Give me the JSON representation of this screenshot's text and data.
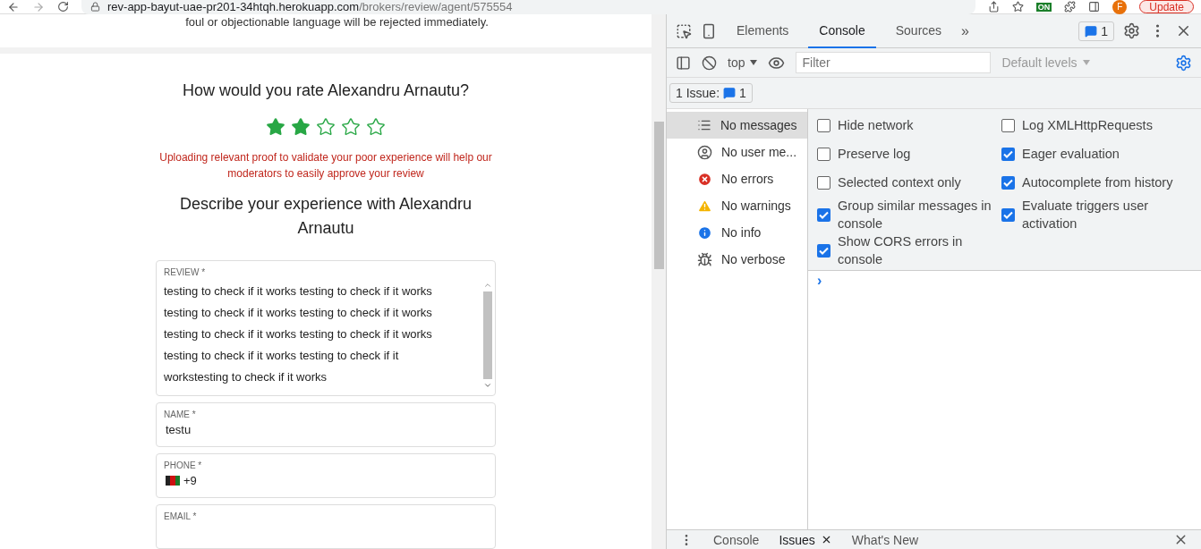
{
  "browser": {
    "url_host": "rev-app-bayut-uae-pr201-34htqh.herokuapp.com",
    "url_path": "/brokers/review/agent/575554",
    "extension_badge": "ON",
    "profile_initial": "F",
    "update_button": "Update"
  },
  "page": {
    "notice": "foul or objectionable language will be rejected immediately.",
    "rate_title": "How would you rate Alexandru Arnautu?",
    "stars": 2,
    "proof_note": "Uploading relevant proof to validate your poor experience will help our moderators to easily approve your review",
    "describe_title": "Describe your experience with Alexandru Arnautu",
    "review": {
      "label": "REVIEW *",
      "value": "testing to check if it works testing to check if it works testing to check if it works testing to check if it works testing to check if it works testing to check if it works testing to check if it works testing to check if it workstesting to check if it works"
    },
    "name": {
      "label": "NAME *",
      "value": "testu"
    },
    "phone": {
      "label": "PHONE *",
      "value": "+9"
    },
    "email": {
      "label": "EMAIL *"
    }
  },
  "devtools": {
    "tabs": [
      {
        "label": "Elements",
        "selected": false
      },
      {
        "label": "Console",
        "selected": true
      },
      {
        "label": "Sources",
        "selected": false
      }
    ],
    "more_tabs": "»",
    "issues_badge": "1",
    "context": "top",
    "filter": {
      "placeholder": "Filter"
    },
    "levels": "Default levels",
    "issues_button": {
      "label": "1 Issue:",
      "count": "1"
    },
    "sidebar": [
      {
        "kind": "list",
        "label": "No messages",
        "selected": true
      },
      {
        "kind": "user",
        "label": "No user me...",
        "selected": false
      },
      {
        "kind": "error",
        "label": "No errors",
        "selected": false
      },
      {
        "kind": "warning",
        "label": "No warnings",
        "selected": false
      },
      {
        "kind": "info",
        "label": "No info",
        "selected": false
      },
      {
        "kind": "verbose",
        "label": "No verbose",
        "selected": false
      }
    ],
    "settings_left": [
      {
        "label": "Hide network",
        "checked": false
      },
      {
        "label": "Preserve log",
        "checked": false
      },
      {
        "label": "Selected context only",
        "checked": false
      },
      {
        "label": "Group similar messages in console",
        "checked": true
      },
      {
        "label": "Show CORS errors in console",
        "checked": true
      }
    ],
    "settings_right": [
      {
        "label": "Log XMLHttpRequests",
        "checked": false
      },
      {
        "label": "Eager evaluation",
        "checked": true
      },
      {
        "label": "Autocomplete from history",
        "checked": true
      },
      {
        "label": "Evaluate triggers user activation",
        "checked": true
      }
    ],
    "prompt": "›",
    "drawer_tabs": [
      {
        "label": "Console",
        "selected": false,
        "closable": false
      },
      {
        "label": "Issues",
        "selected": true,
        "closable": true
      },
      {
        "label": "What's New",
        "selected": false,
        "closable": false
      }
    ]
  }
}
